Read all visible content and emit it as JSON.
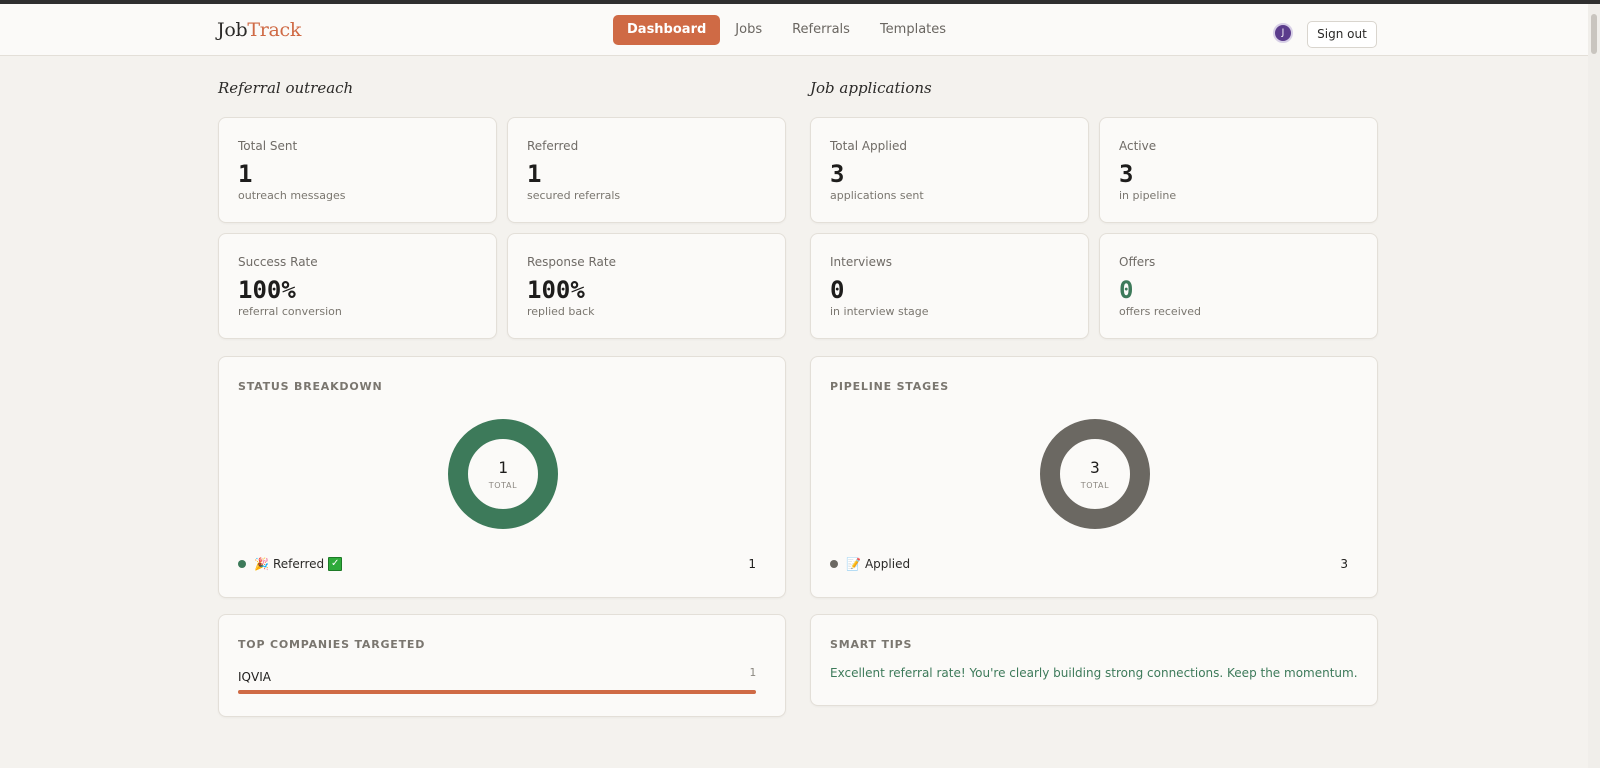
{
  "header": {
    "brand_main": "Job",
    "brand_accent": "Track",
    "nav": [
      "Dashboard",
      "Jobs",
      "Referrals",
      "Templates"
    ],
    "active_nav": "Dashboard",
    "avatar_initial": "J",
    "signout_label": "Sign out"
  },
  "colors": {
    "accent": "#cf6a45",
    "referred_green": "#3d7a5a",
    "applied_gray": "#6b6862",
    "tip_green": "#3d7a5a"
  },
  "referral": {
    "section_title": "Referral outreach",
    "stats": [
      {
        "label": "Total Sent",
        "value": "1",
        "sub": "outreach messages"
      },
      {
        "label": "Referred",
        "value": "1",
        "sub": "secured referrals"
      },
      {
        "label": "Success Rate",
        "value": "100%",
        "sub": "referral conversion"
      },
      {
        "label": "Response Rate",
        "value": "100%",
        "sub": "replied back"
      }
    ],
    "status_breakdown": {
      "title": "STATUS BREAKDOWN",
      "total": "1",
      "total_label": "TOTAL",
      "legend": [
        {
          "emoji": "🎉",
          "label": "Referred",
          "badge": "✓",
          "count": "1",
          "color": "#3d7a5a"
        }
      ]
    },
    "top_companies": {
      "title": "TOP COMPANIES TARGETED",
      "items": [
        {
          "name": "IQVIA",
          "count": "1",
          "fraction": 1.0
        }
      ]
    }
  },
  "jobs": {
    "section_title": "Job applications",
    "stats": [
      {
        "label": "Total Applied",
        "value": "3",
        "sub": "applications sent"
      },
      {
        "label": "Active",
        "value": "3",
        "sub": "in pipeline"
      },
      {
        "label": "Interviews",
        "value": "0",
        "sub": "in interview stage"
      },
      {
        "label": "Offers",
        "value": "0",
        "sub": "offers received"
      }
    ],
    "pipeline": {
      "title": "PIPELINE STAGES",
      "total": "3",
      "total_label": "TOTAL",
      "legend": [
        {
          "emoji": "📝",
          "label": "Applied",
          "count": "3",
          "color": "#6b6862"
        }
      ]
    },
    "smart_tips": {
      "title": "SMART TIPS",
      "text": "Excellent referral rate! You're clearly building strong connections. Keep the momentum."
    }
  }
}
